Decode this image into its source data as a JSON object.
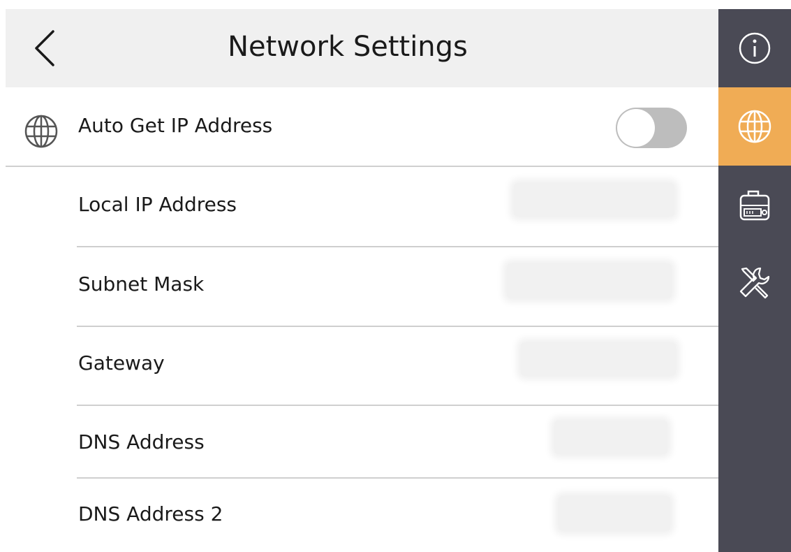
{
  "header": {
    "title": "Network Settings",
    "back_icon": "chevron-left-icon"
  },
  "auto_ip": {
    "label": "Auto Get IP Address",
    "icon": "globe-icon",
    "enabled": false
  },
  "fields": [
    {
      "label": "Local IP Address",
      "value": ""
    },
    {
      "label": "Subnet Mask",
      "value": ""
    },
    {
      "label": "Gateway",
      "value": ""
    },
    {
      "label": "DNS Address",
      "value": ""
    },
    {
      "label": "DNS Address 2",
      "value": ""
    }
  ],
  "sidebar": {
    "items": [
      {
        "icon": "info-icon",
        "active": false
      },
      {
        "icon": "globe-icon",
        "active": true
      },
      {
        "icon": "device-icon",
        "active": false
      },
      {
        "icon": "tools-icon",
        "active": false
      }
    ]
  },
  "colors": {
    "accent": "#f0ac55",
    "sidebar_bg": "#4a4a55",
    "header_bg": "#f0f0f0",
    "toggle_off": "#bdbdbd"
  }
}
